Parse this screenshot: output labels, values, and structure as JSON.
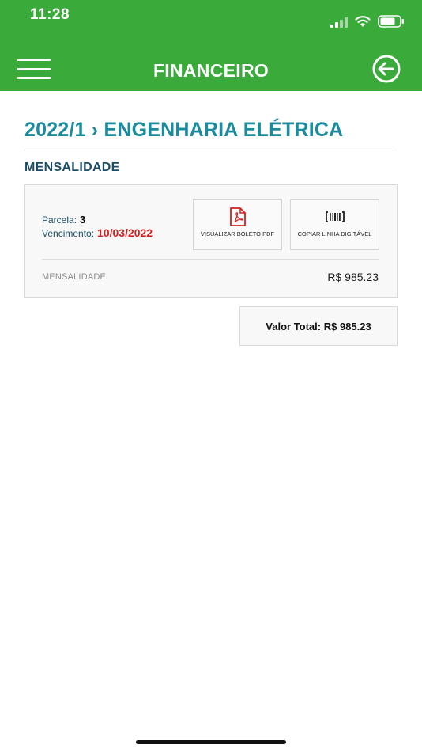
{
  "status_bar": {
    "time": "11:28"
  },
  "app_bar": {
    "title": "FINANCEIRO"
  },
  "course": {
    "title": "2022/1 › ENGENHARIA ELÉTRICA"
  },
  "section": {
    "title": "MENSALIDADE"
  },
  "invoice": {
    "parcela_label": "Parcela:",
    "parcela_value": "3",
    "vencimento_label": "Vencimento:",
    "vencimento_value": "10/03/2022",
    "due_color": "#d32020",
    "actions": [
      {
        "label": "VISUALIZAR BOLETO PDF",
        "icon": "pdf-icon"
      },
      {
        "label": "COPIAR LINHA DIGITÁVEL",
        "icon": "barcode-icon"
      }
    ],
    "item_label": "MENSALIDADE",
    "item_value": "R$ 985.23"
  },
  "total": {
    "text": "Valor Total: R$ 985.23"
  },
  "colors": {
    "header": "#3aaa3a",
    "course_title": "#1a8c9e",
    "section_title": "#1c4d66"
  }
}
